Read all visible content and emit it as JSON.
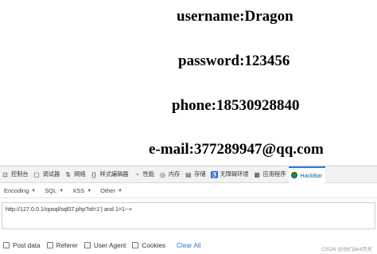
{
  "page": {
    "lines": [
      "username:Dragon",
      "password:123456",
      "phone:18530928840",
      "e-mail:377289947@qq.com"
    ]
  },
  "devtools": {
    "tabs": [
      {
        "label": "控制台",
        "icon": "console-icon"
      },
      {
        "label": "调试器",
        "icon": "debugger-icon"
      },
      {
        "label": "网络",
        "icon": "network-icon"
      },
      {
        "label": "样式编辑器",
        "icon": "style-editor-icon"
      },
      {
        "label": "性能",
        "icon": "performance-icon"
      },
      {
        "label": "内存",
        "icon": "memory-icon"
      },
      {
        "label": "存储",
        "icon": "storage-icon"
      },
      {
        "label": "无障碍环境",
        "icon": "accessibility-icon"
      },
      {
        "label": "应用程序",
        "icon": "application-icon"
      },
      {
        "label": "HackBar",
        "icon": "hackbar-icon"
      }
    ],
    "active_tab": "HackBar",
    "toolbar": {
      "encoding": "Encoding",
      "sql": "SQL",
      "xss": "XSS",
      "other": "Other"
    },
    "url_value": "http://127.0.0.1/opsql/sql07.php?id=1') and 1=1--+",
    "options": {
      "post_data": "Post data",
      "referer": "Referer",
      "user_agent": "User Agent",
      "cookies": "Cookies",
      "clear_all": "Clear All"
    },
    "watermark": "CSDN @你们de4月天"
  }
}
